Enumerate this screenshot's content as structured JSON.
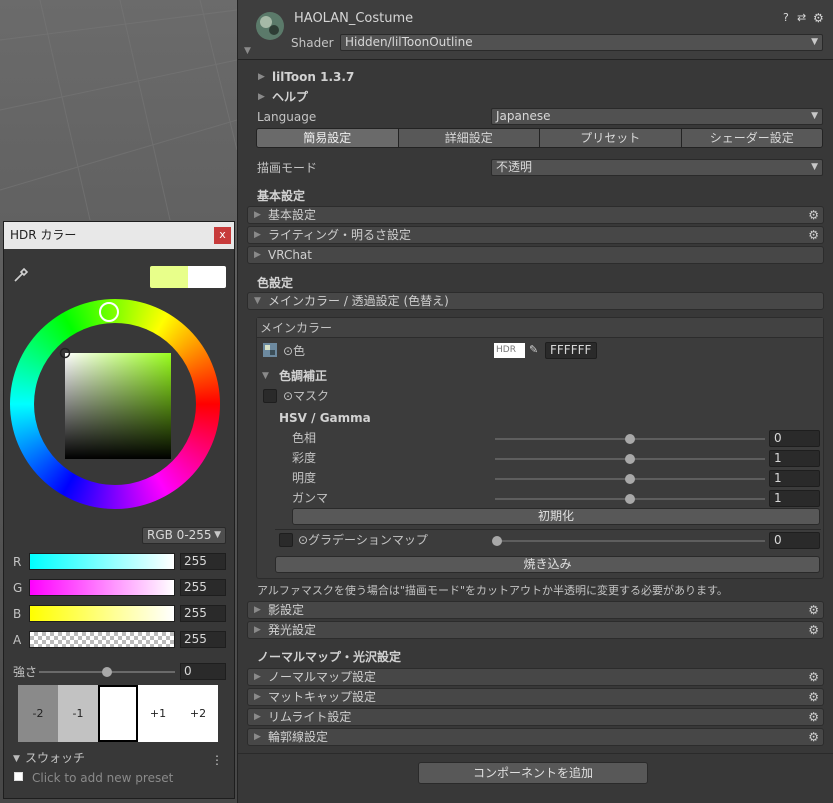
{
  "header": {
    "object_name": "HAOLAN_Costume",
    "shader_label": "Shader",
    "shader_value": "Hidden/lilToonOutline",
    "help_icon": "?",
    "preset_icon": "⇄",
    "settings_icon": "⚙"
  },
  "liltoon": {
    "version_label": "lilToon 1.3.7",
    "help_label": "ヘルプ",
    "language_label": "Language",
    "language_value": "Japanese",
    "tabs": [
      "簡易設定",
      "詳細設定",
      "プリセット",
      "シェーダー設定"
    ],
    "render_mode_label": "描画モード",
    "render_mode_value": "不透明"
  },
  "basic": {
    "heading": "基本設定",
    "sections": [
      "基本設定",
      "ライティング・明るさ設定",
      "VRChat"
    ]
  },
  "color": {
    "heading": "色設定",
    "main_section": "メインカラー / 透過設定 (色替え)",
    "main_color_header": "メインカラー",
    "color_label": "⊙色",
    "hdr_label": "HDR",
    "hex_value": "FFFFFF",
    "tone_heading": "色調補正",
    "mask_label": "⊙マスク",
    "hsv_heading": "HSV / Gamma",
    "sliders": [
      {
        "label": "色相",
        "value": "0",
        "fraction": 0.5
      },
      {
        "label": "彩度",
        "value": "1",
        "fraction": 0.5
      },
      {
        "label": "明度",
        "value": "1",
        "fraction": 0.5
      },
      {
        "label": "ガンマ",
        "value": "1",
        "fraction": 0.5
      }
    ],
    "reset_button": "初期化",
    "gradation_label": "⊙グラデーションマップ",
    "gradation_value": "0",
    "bake_button": "焼き込み",
    "alpha_note": "アルファマスクを使う場合は\"描画モード\"をカットアウトか半透明に変更する必要があります。"
  },
  "more_sections": [
    "影設定",
    "発光設定"
  ],
  "normal": {
    "heading": "ノーマルマップ・光沢設定",
    "sections": [
      "ノーマルマップ設定",
      "マットキャップ設定",
      "リムライト設定",
      "輪郭線設定"
    ]
  },
  "add_component_button": "コンポーネントを追加",
  "hdr_window": {
    "title": "HDR カラー",
    "close_label": "x",
    "current_color": "#e8ff8a",
    "original_color": "#ffffff",
    "mode": "RGB 0-255",
    "channels": [
      {
        "name": "R",
        "value": "255"
      },
      {
        "name": "G",
        "value": "255"
      },
      {
        "name": "B",
        "value": "255"
      },
      {
        "name": "A",
        "value": "255"
      }
    ],
    "intensity_label": "強さ",
    "intensity_value": "0",
    "intensity_steps": [
      "-2",
      "-1",
      "",
      "+1",
      "+2"
    ],
    "swatches_label": "スウォッチ",
    "add_preset": "Click to add new preset"
  }
}
